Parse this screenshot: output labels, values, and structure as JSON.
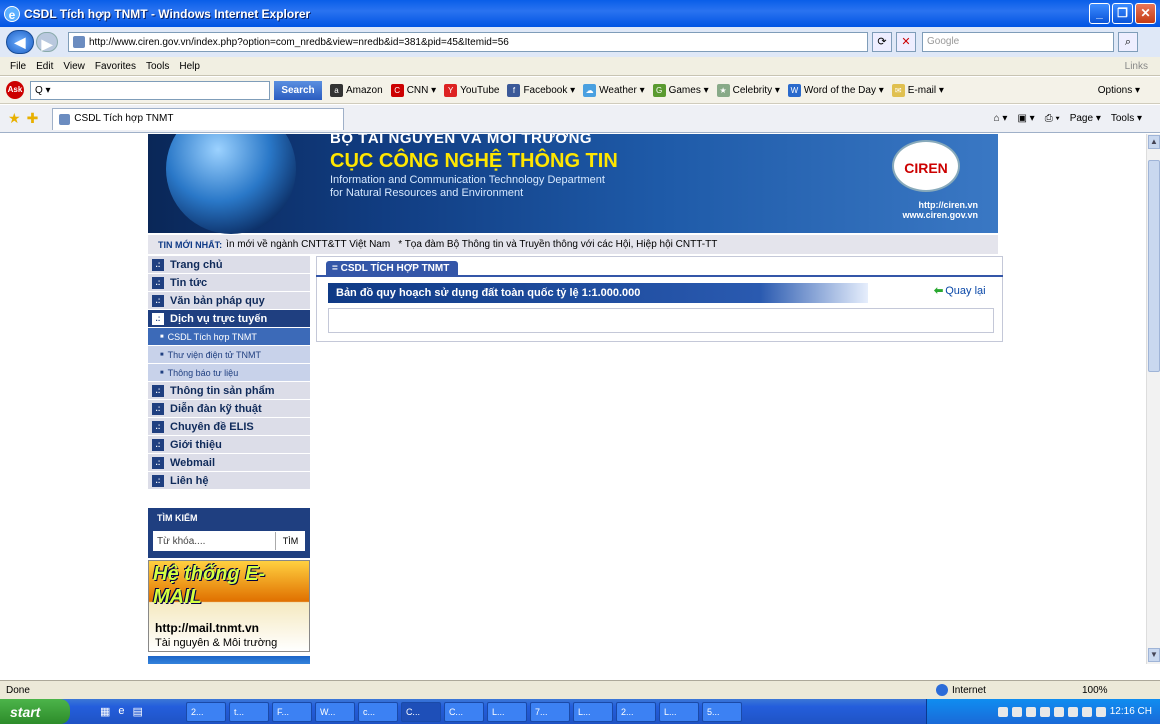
{
  "window": {
    "title": "CSDL Tích hợp TNMT - Windows Internet Explorer"
  },
  "address": {
    "url": "http://www.ciren.gov.vn/index.php?option=com_nredb&view=nredb&id=381&pid=45&Itemid=56",
    "search_placeholder": "Google"
  },
  "menu": [
    "File",
    "Edit",
    "View",
    "Favorites",
    "Tools",
    "Help"
  ],
  "menu_links": "Links",
  "toolbar": {
    "search_placeholder": "Q ▾",
    "search_button": "Search",
    "items": [
      "Amazon",
      "CNN ▾",
      "YouTube",
      "Facebook ▾",
      "Weather ▾",
      "Games ▾",
      "Celebrity ▾",
      "Word of the Day ▾",
      "E-mail ▾"
    ],
    "options": "Options ▾"
  },
  "tab": {
    "label": "CSDL Tích hợp TNMT"
  },
  "tabtools": {
    "page": "Page ▾",
    "tools": "Tools ▾"
  },
  "banner": {
    "top": "BỘ TÀI NGUYÊN VÀ MÔI TRƯỜNG",
    "title": "CỤC CÔNG NGHỆ THÔNG TIN",
    "en1": "Information and Communication Technology Department",
    "en2": "for Natural Resources and Environment",
    "logo": "CIREN",
    "url1": "http://ciren.vn",
    "url2": "www.ciren.gov.vn"
  },
  "ticker": {
    "label": "TIN MỚI NHẤT:",
    "items": [
      "ìn mới về ngành CNTT&TT Việt Nam",
      "* Tọa đàm Bộ Thông tin và Truyền thông với các Hội, Hiệp hội CNTT-TT"
    ]
  },
  "nav": {
    "items": [
      "Trang chủ",
      "Tin tức",
      "Văn bản pháp quy",
      "Dịch vụ trực tuyến"
    ],
    "subitems": [
      "CSDL Tích hợp TNMT",
      "Thư viện điện tử TNMT",
      "Thông báo tư liệu"
    ],
    "items2": [
      "Thông tin sản phẩm",
      "Diễn đàn kỹ thuật",
      "Chuyên đề ELIS",
      "Giới thiệu",
      "Webmail",
      "Liên hệ"
    ]
  },
  "search": {
    "header": "TÌM KIẾM",
    "placeholder": "Từ khóa....",
    "button": "TÌM"
  },
  "mailad": {
    "headline": "Hệ thống E-MAIL",
    "url": "http://mail.tnmt.vn",
    "sub": "Tài nguyên & Môi trường"
  },
  "panel": {
    "tab": "= CSDL TÍCH HỢP TNMT",
    "title": "Bản đồ quy hoạch sử dụng đất toàn quốc tỷ lệ 1:1.000.000",
    "back": "Quay lại"
  },
  "status": {
    "text": "Done",
    "zone": "Internet",
    "zoom": "100%"
  },
  "taskbar": {
    "start": "start",
    "tasks": [
      "2...",
      "t...",
      "F...",
      "W...",
      "c...",
      "C...",
      "C...",
      "L...",
      "7...",
      "L...",
      "2...",
      "L...",
      "5..."
    ],
    "clock": "12:16 CH"
  }
}
